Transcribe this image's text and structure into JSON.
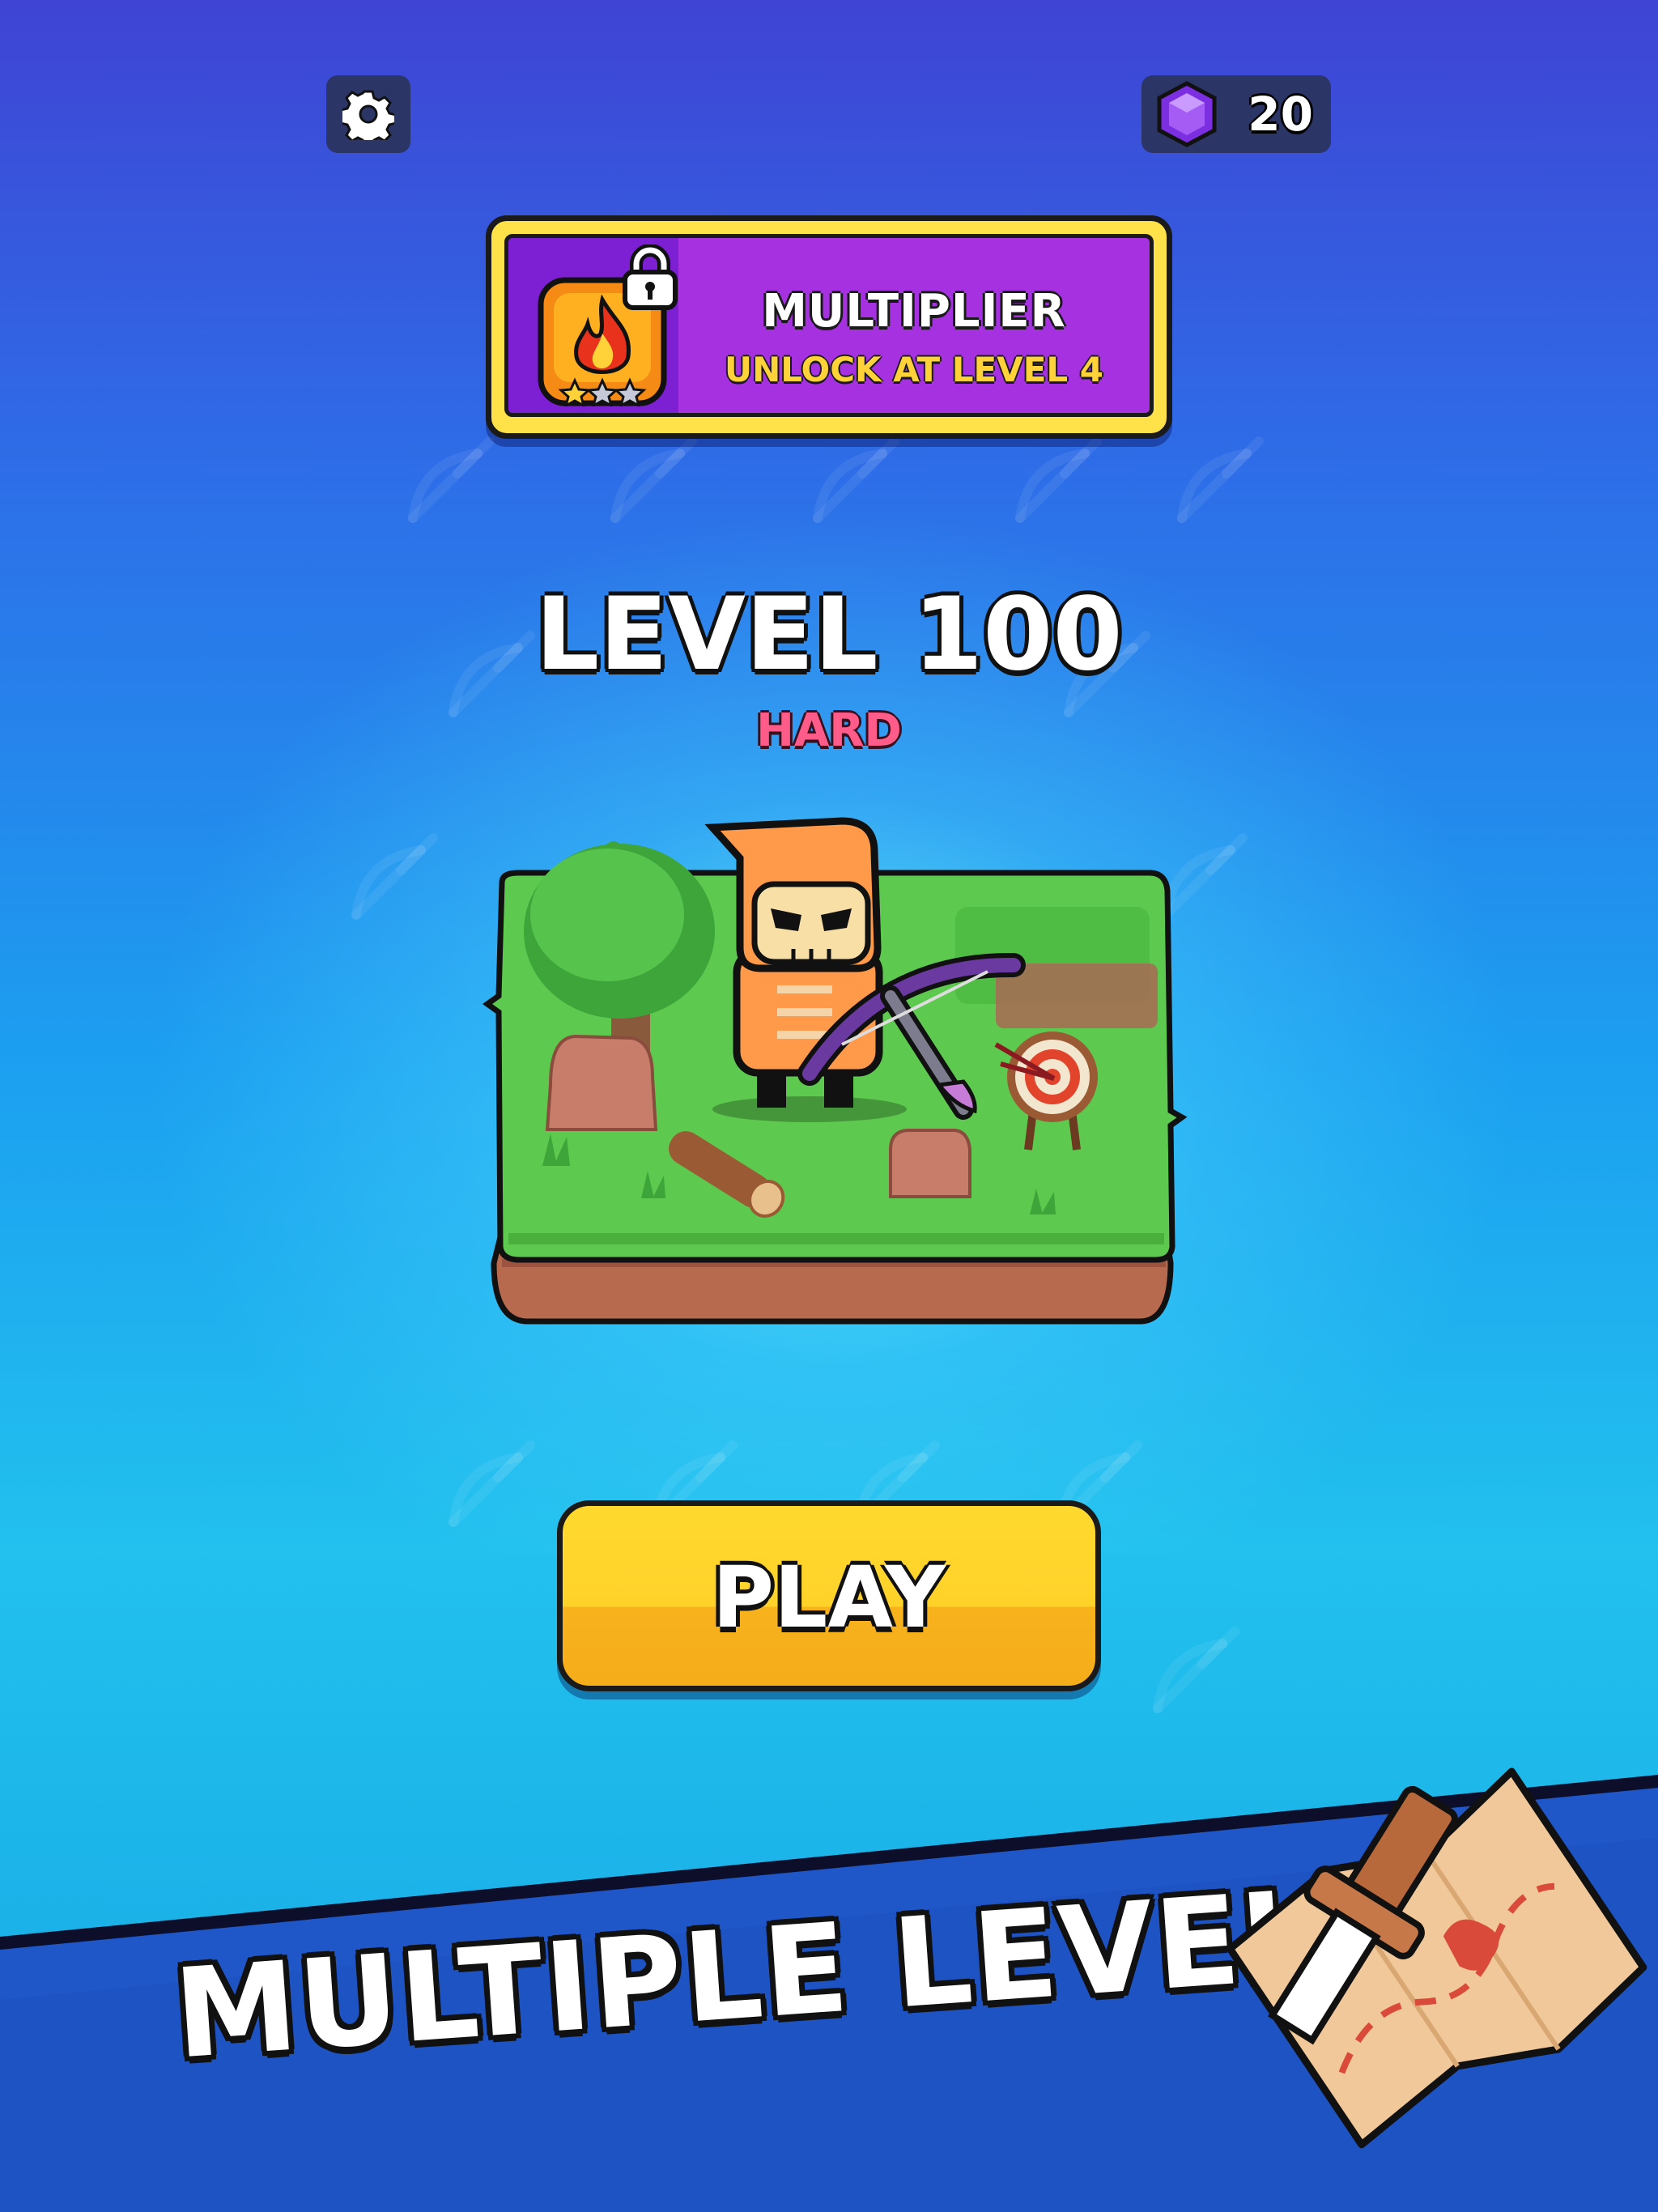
{
  "colors": {
    "panel": "#2b3566",
    "banner_purple": "#a531e0",
    "banner_gold": "#ffe14a",
    "difficulty_pink": "#ff5c8a",
    "play_yellow": "#ffd22a",
    "band_blue": "#1f56c8"
  },
  "topbar": {
    "settings_icon": "gear-icon",
    "gem_icon": "purple-gem-icon",
    "gem_count": "20"
  },
  "multiplier": {
    "icon": "fire-icon",
    "lock_icon": "lock-icon",
    "stars_filled": 1,
    "stars_total": 3,
    "title": "MULTIPLIER",
    "subtitle": "UNLOCK AT LEVEL 4"
  },
  "level": {
    "title": "LEVEL 100",
    "difficulty": "HARD"
  },
  "play_button": {
    "label": "PLAY"
  },
  "promo": {
    "text": "MULTIPLE LEVELS"
  }
}
